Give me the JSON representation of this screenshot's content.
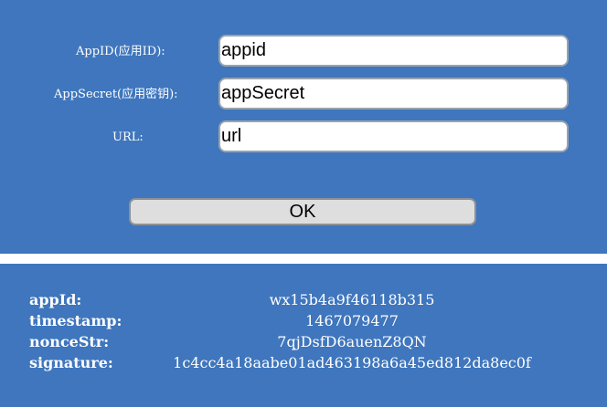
{
  "form": {
    "appid_label": "AppID(应用ID):",
    "appid_value": "appid",
    "appsecret_label": "AppSecret(应用密钥):",
    "appsecret_value": "appSecret",
    "url_label": "URL:",
    "url_value": "url",
    "ok_label": "OK"
  },
  "result": {
    "rows": [
      {
        "key": "appId:",
        "value": "wx15b4a9f46118b315"
      },
      {
        "key": "timestamp:",
        "value": "1467079477"
      },
      {
        "key": "nonceStr:",
        "value": "7qjDsfD6auenZ8QN"
      },
      {
        "key": "signature:",
        "value": "1c4cc4a18aabe01ad463198a6a45ed812da8ec0f"
      }
    ]
  },
  "colors": {
    "panel_background": "#3f76bd",
    "text": "#ffffff",
    "button_background": "#dedede"
  }
}
